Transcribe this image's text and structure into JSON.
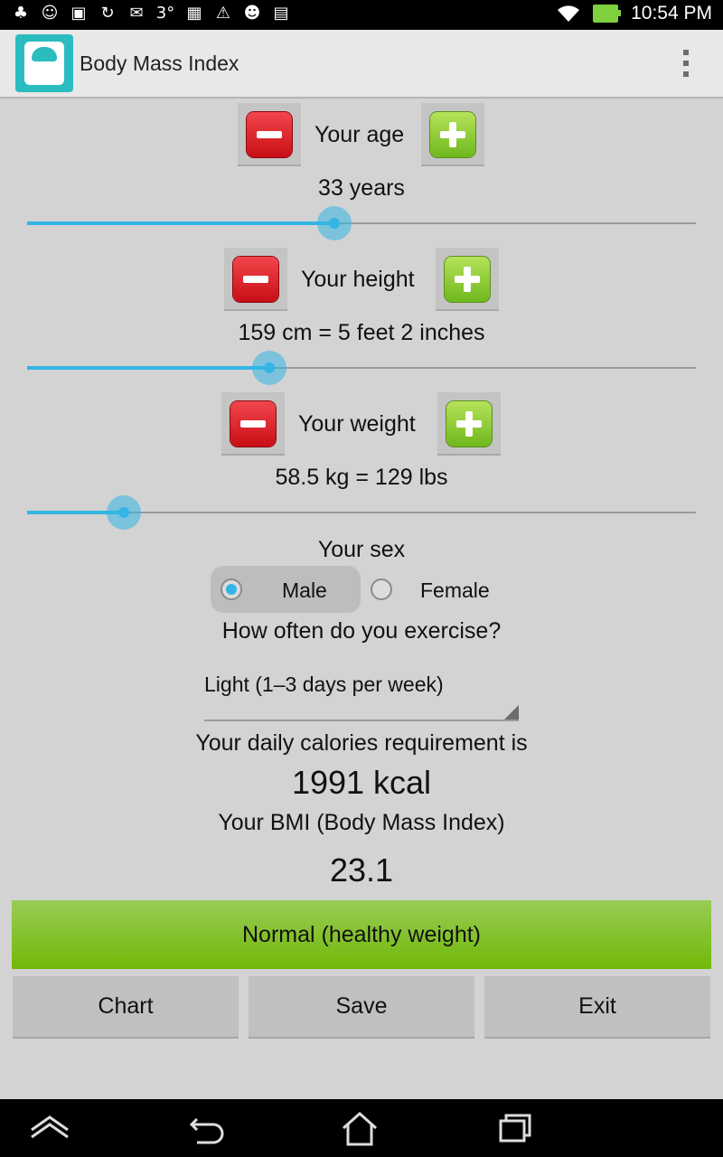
{
  "status_bar": {
    "time": "10:54 PM",
    "left_icons": [
      "android-debug-icon",
      "android-mascot-icon",
      "gallery-icon",
      "sync-icon",
      "gmail-icon",
      "three-icon",
      "camera-icon",
      "warning-icon",
      "android-icon",
      "store-icon"
    ],
    "left_glyphs": [
      "♣",
      "☺",
      "▣",
      "↻",
      "✉",
      "3°",
      "▦",
      "⚠",
      "☻",
      "▤"
    ]
  },
  "action_bar": {
    "title": "Body Mass Index"
  },
  "age": {
    "label": "Your age",
    "value_text": "33 years",
    "slider_fraction": 0.459
  },
  "height": {
    "label": "Your height",
    "value_text": "159 cm = 5 feet 2 inches",
    "slider_fraction": 0.362
  },
  "weight": {
    "label": "Your weight",
    "value_text": "58.5 kg = 129 lbs",
    "slider_fraction": 0.145
  },
  "sex": {
    "label": "Your sex",
    "options": [
      "Male",
      "Female"
    ],
    "selected": "Male"
  },
  "exercise": {
    "label": "How often do you exercise?",
    "selected": "Light (1–3 days per week)"
  },
  "calories": {
    "label": "Your daily calories requirement is",
    "value": "1991 kcal"
  },
  "bmi": {
    "label": "Your BMI (Body Mass Index)",
    "value": "23.1",
    "status": "Normal (healthy weight)",
    "status_color": "#7cbd1c"
  },
  "buttons": {
    "chart": "Chart",
    "save": "Save",
    "exit": "Exit"
  }
}
